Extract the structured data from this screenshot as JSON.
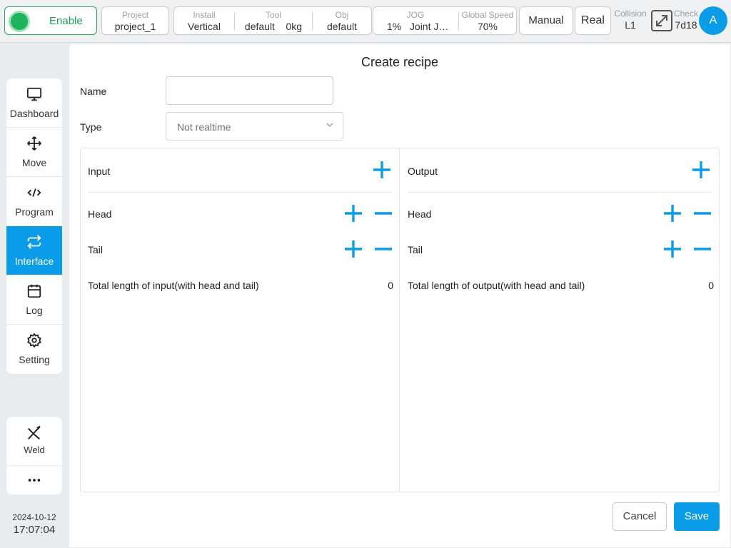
{
  "topbar": {
    "enable_label": "Enable",
    "project": {
      "label": "Project",
      "value": "project_1"
    },
    "install": {
      "label": "Install",
      "value": "Vertical"
    },
    "tool": {
      "label": "Tool",
      "value": "default",
      "payload": "0kg"
    },
    "obj": {
      "label": "Obj",
      "value": "default"
    },
    "jog": {
      "label": "JOG",
      "percent": "1%",
      "mode": "Joint J…"
    },
    "global_speed": {
      "label": "Global Speed",
      "value": "70%"
    },
    "manual_label": "Manual",
    "real_label": "Real",
    "collision": {
      "label": "Collision",
      "value": "L1"
    },
    "check": {
      "label": "Check",
      "value": "7d18"
    },
    "avatar_letter": "A"
  },
  "sidebar": {
    "items": [
      {
        "label": "Dashboard",
        "icon": "monitor-icon"
      },
      {
        "label": "Move",
        "icon": "move-arrows-icon"
      },
      {
        "label": "Program",
        "icon": "code-icon"
      },
      {
        "label": "Interface",
        "icon": "swap-arrows-icon",
        "active": true
      },
      {
        "label": "Log",
        "icon": "calendar-icon"
      },
      {
        "label": "Setting",
        "icon": "gear-icon"
      }
    ],
    "extra": [
      {
        "label": "Weld",
        "icon": "weld-torch-icon"
      },
      {
        "label": "",
        "icon": "more-icon"
      }
    ],
    "date": "2024-10-12",
    "time": "17:07:04"
  },
  "form": {
    "title": "Create recipe",
    "name_label": "Name",
    "name_value": "",
    "type_label": "Type",
    "type_value": "Not realtime"
  },
  "input_col": {
    "header": "Input",
    "head_label": "Head",
    "tail_label": "Tail",
    "total_label": "Total length of input(with head and tail)",
    "total_value": "0"
  },
  "output_col": {
    "header": "Output",
    "head_label": "Head",
    "tail_label": "Tail",
    "total_label": "Total length of output(with head and tail)",
    "total_value": "0"
  },
  "actions": {
    "cancel_label": "Cancel",
    "save_label": "Save"
  },
  "colors": {
    "accent": "#0a9ce8",
    "enable_green": "#1fb35c"
  }
}
